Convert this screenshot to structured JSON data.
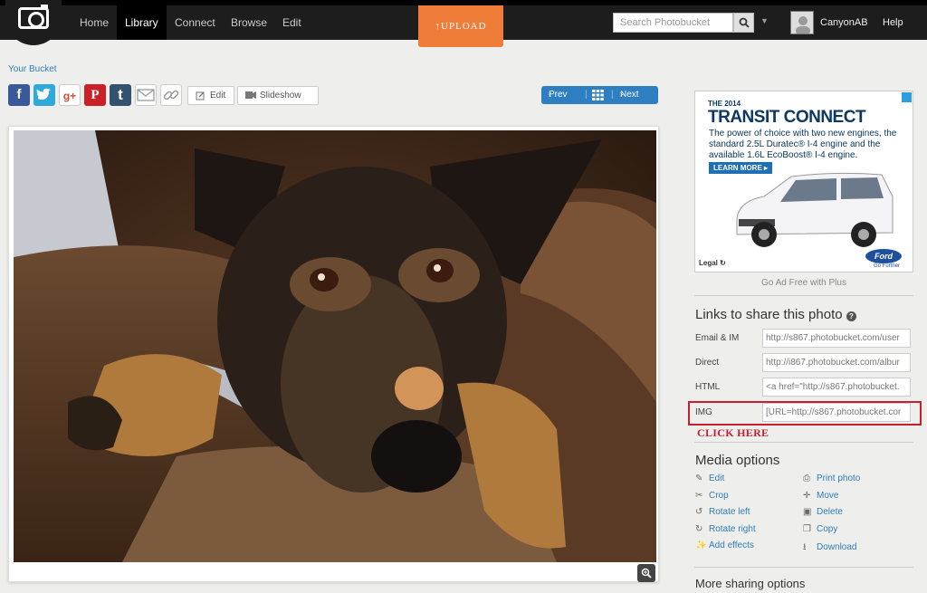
{
  "nav": {
    "items": [
      "Home",
      "Library",
      "Connect",
      "Browse",
      "Edit"
    ],
    "upload_label": "UPLOAD",
    "search_placeholder": "Search Photobucket",
    "username": "CanyonAB",
    "help_label": "Help"
  },
  "breadcrumb": "Your Bucket",
  "toolbar": {
    "share_icons": [
      "facebook-icon",
      "twitter-icon",
      "google-plus-icon",
      "pinterest-icon",
      "tumblr-icon",
      "email-icon",
      "link-icon"
    ],
    "edit_label": "Edit",
    "slideshow_label": "Slideshow",
    "prev_label": "Prev",
    "next_label": "Next"
  },
  "ad": {
    "year": "THE 2014",
    "title": "TRANSIT CONNECT",
    "body": "The power of choice with two new engines, the standard 2.5L Duratec® I-4 engine and the available 1.6L EcoBoost® I-4 engine.",
    "cta": "LEARN MORE ▸",
    "legal": "Legal",
    "brand": "Ford",
    "brand_tagline": "Go Further",
    "ad_free": "Go Ad Free with Plus"
  },
  "links": {
    "title": "Links to share this photo",
    "rows": [
      {
        "label": "Email & IM",
        "value": "http://s867.photobucket.com/user"
      },
      {
        "label": "Direct",
        "value": "http://i867.photobucket.com/albur"
      },
      {
        "label": "HTML",
        "value": "<a href=\"http://s867.photobucket."
      },
      {
        "label": "IMG",
        "value": "[URL=http://s867.photobucket.cor"
      }
    ],
    "annotation": "CLICK HERE"
  },
  "media": {
    "title": "Media options",
    "left": [
      "Edit",
      "Crop",
      "Rotate left",
      "Rotate right",
      "Add effects"
    ],
    "right": [
      "Print photo",
      "Move",
      "Delete",
      "Copy",
      "Download"
    ]
  },
  "more_sharing": "More sharing options",
  "colors": {
    "accent_blue": "#2e7ec2",
    "upload_orange": "#f07c3a",
    "annotation_red": "#c8202e"
  }
}
